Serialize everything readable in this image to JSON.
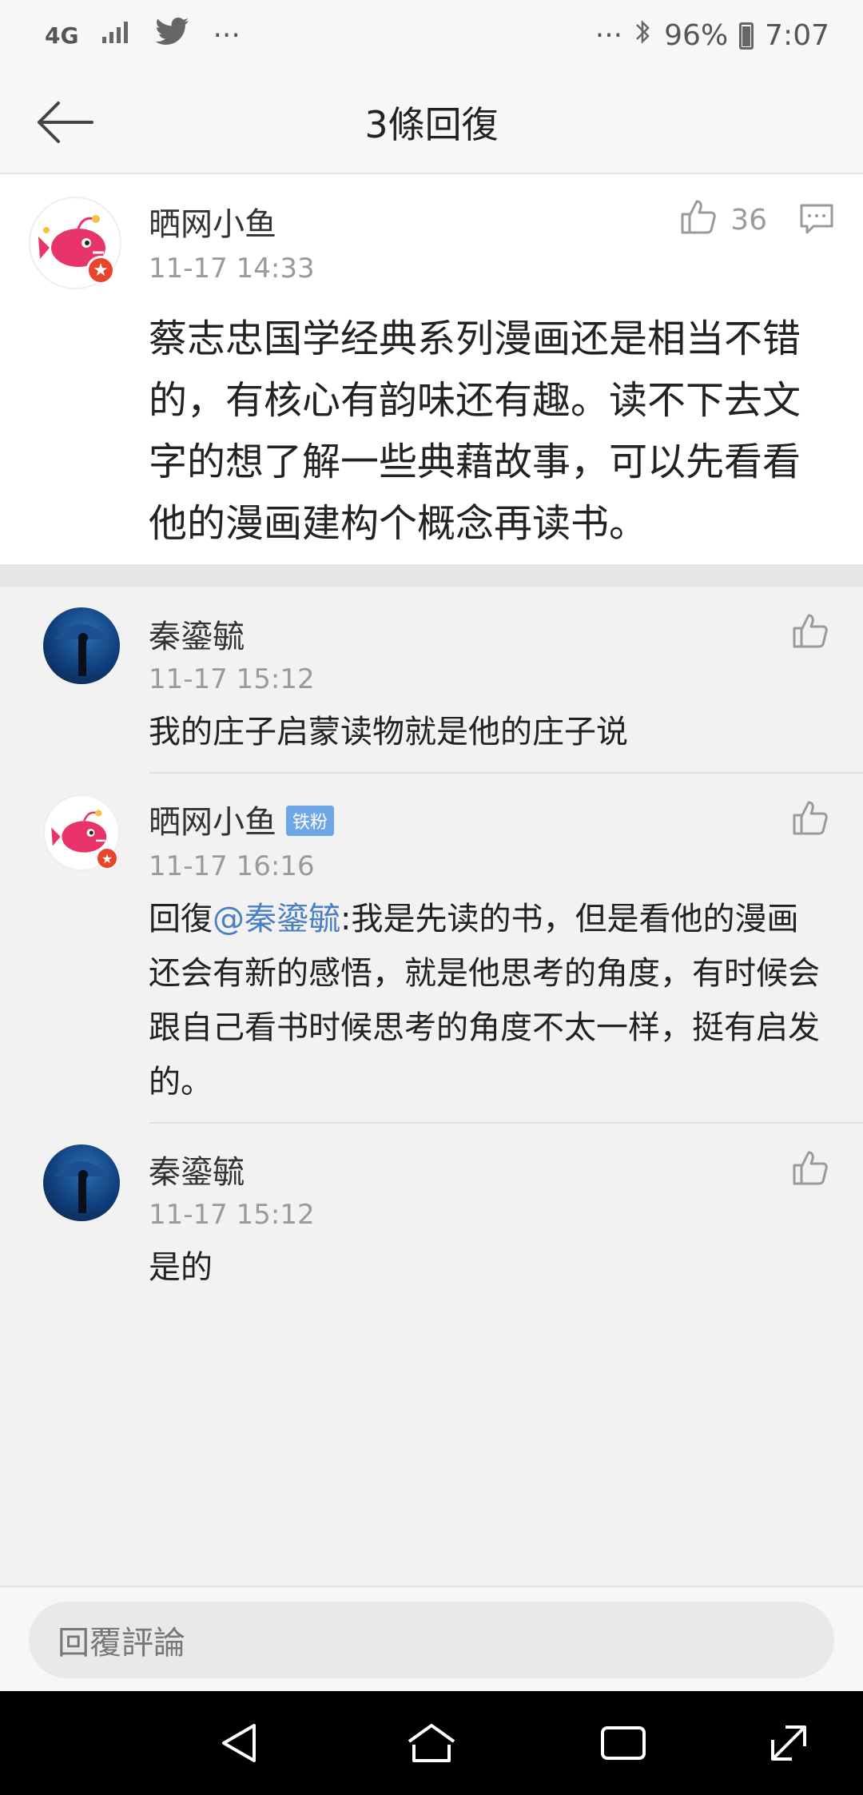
{
  "status_bar": {
    "network": "4G",
    "right_text": "···",
    "left_more": "···",
    "battery": "96%",
    "time": "7:07",
    "icons": [
      "signal-icon",
      "twitter-icon",
      "bluetooth-icon",
      "battery-icon"
    ]
  },
  "nav": {
    "title": "3條回復",
    "back_icon": "back-arrow-icon"
  },
  "main_comment": {
    "username": "晒网小鱼",
    "timestamp": "11-17 14:33",
    "likes": "36",
    "content": "蔡志忠国学经典系列漫画还是相当不错的，有核心有韵味还有趣。读不下去文字的想了解一些典藉故事，可以先看看他的漫画建构个概念再读书。"
  },
  "replies": [
    {
      "username": "秦鎏毓",
      "timestamp": "11-17 15:12",
      "content": "我的庄子启蒙读物就是他的庄子说"
    },
    {
      "username": "晒网小鱼",
      "badge": "铁粉",
      "timestamp": "11-17 16:16",
      "reply_prefix": "回復",
      "mention": "@秦鎏毓",
      "content": ":我是先读的书，但是看他的漫画还会有新的感悟，就是他思考的角度，有时候会跟自己看书时候思考的角度不太一样，挺有启发的。"
    },
    {
      "username": "秦鎏毓",
      "timestamp": "11-17 15:12",
      "content": "是的"
    }
  ],
  "composer": {
    "placeholder": "回覆評論"
  },
  "colors": {
    "mention": "#4b7fc4",
    "badge": "#6fa6e6",
    "gray_text": "#9a9a9a"
  }
}
